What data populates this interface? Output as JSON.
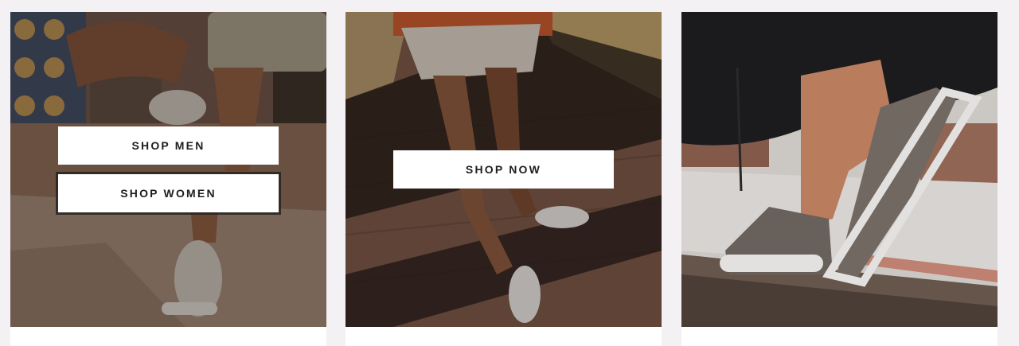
{
  "cards": [
    {
      "scene": "man-and-woman-in-sneakers-on-tile-steps",
      "buttons": [
        {
          "label": "SHOP MEN"
        },
        {
          "label": "SHOP WOMEN"
        }
      ]
    },
    {
      "scene": "legs-in-white-flats-on-brick-path",
      "buttons": [
        {
          "label": "SHOP NOW"
        }
      ]
    },
    {
      "scene": "grey-knit-slip-ons-on-sidewalk",
      "buttons": []
    }
  ],
  "colors": {
    "page_background": "#f3f1f3",
    "button_background": "#ffffff",
    "button_text": "#1e1e1e"
  }
}
